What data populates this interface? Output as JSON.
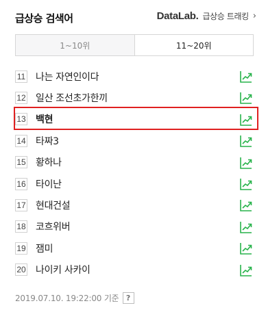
{
  "header": {
    "title": "급상승 검색어",
    "datalab_brand": "DataLab.",
    "datalab_link": "급상승 트래킹",
    "chevron": "›"
  },
  "tabs": [
    {
      "label": "1~10위",
      "selected": false
    },
    {
      "label": "11~20위",
      "selected": true
    }
  ],
  "keywords": [
    {
      "rank": "11",
      "text": "나는 자연인이다",
      "highlighted": false
    },
    {
      "rank": "12",
      "text": "일산 조선초가한끼",
      "highlighted": false
    },
    {
      "rank": "13",
      "text": "백현",
      "highlighted": true
    },
    {
      "rank": "14",
      "text": "타짜3",
      "highlighted": false
    },
    {
      "rank": "15",
      "text": "황하나",
      "highlighted": false
    },
    {
      "rank": "16",
      "text": "타이난",
      "highlighted": false
    },
    {
      "rank": "17",
      "text": "현대건설",
      "highlighted": false
    },
    {
      "rank": "18",
      "text": "코흐위버",
      "highlighted": false
    },
    {
      "rank": "19",
      "text": "잼미",
      "highlighted": false
    },
    {
      "rank": "20",
      "text": "나이키 사카이",
      "highlighted": false
    }
  ],
  "footer": {
    "timestamp": "2019.07.10. 19:22:00 기준",
    "help": "?"
  },
  "colors": {
    "trend_icon": "#27b24a",
    "highlight_border": "#e02020"
  },
  "icons": {
    "trend": "trending-up-icon",
    "chevron": "chevron-right-icon",
    "help": "question-mark-icon"
  }
}
